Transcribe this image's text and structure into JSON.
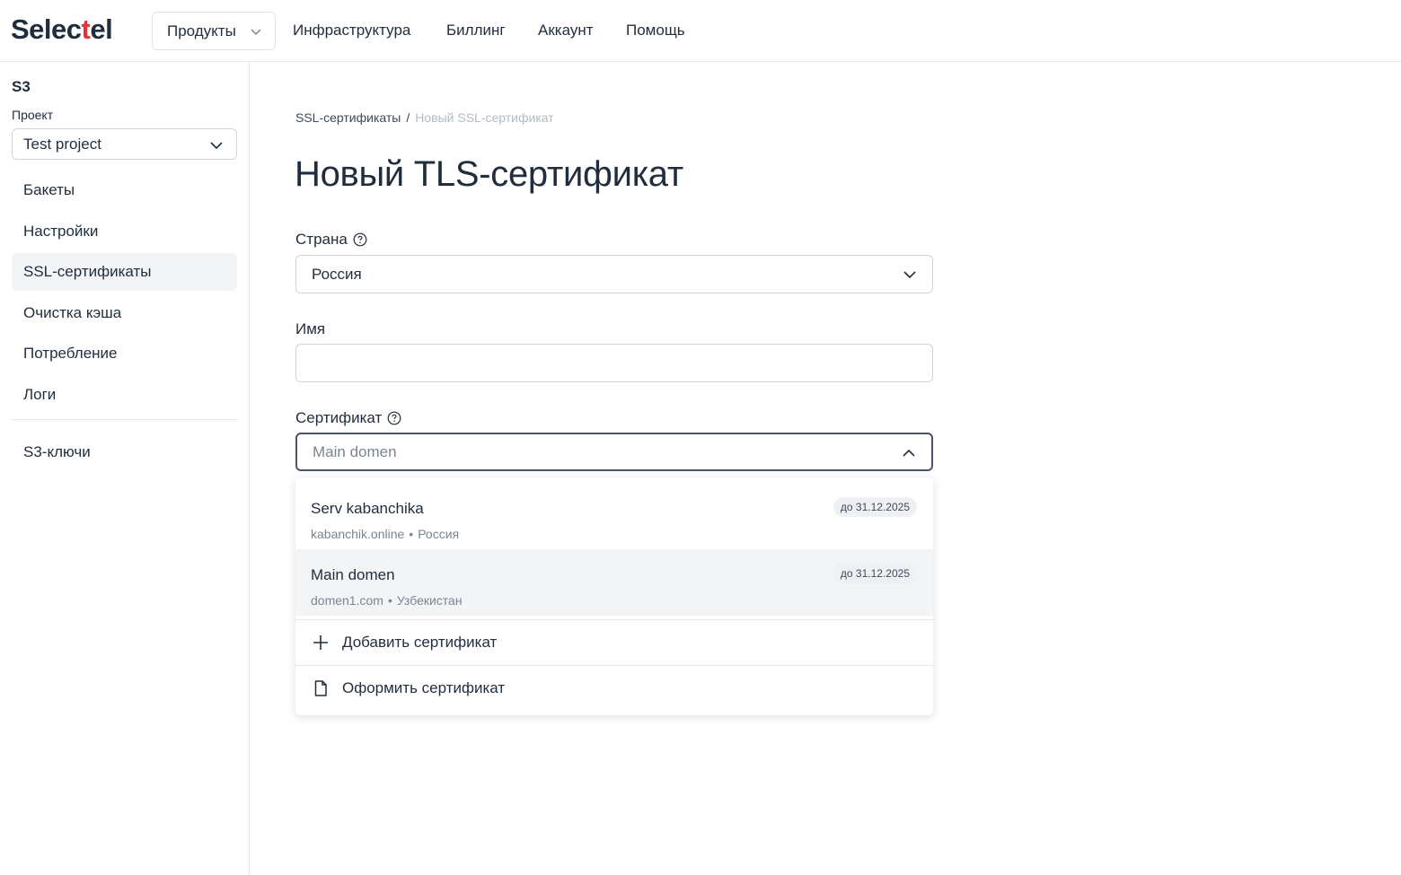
{
  "header": {
    "logo_prefix": "Selec",
    "logo_accent": "t",
    "logo_suffix": "el",
    "nav": {
      "products": "Продукты",
      "infrastructure": "Инфраструктура",
      "billing": "Биллинг",
      "account": "Аккаунт",
      "help": "Помощь"
    }
  },
  "sidebar": {
    "title": "S3",
    "project_label": "Проект",
    "project_value": "Test project",
    "items": [
      {
        "label": "Бакеты"
      },
      {
        "label": "Настройки"
      },
      {
        "label": "SSL-сертификаты"
      },
      {
        "label": "Очистка кэша"
      },
      {
        "label": "Потребление"
      },
      {
        "label": "Логи"
      }
    ],
    "keys_label": "S3-ключи"
  },
  "main": {
    "breadcrumb": {
      "parent": "SSL-сертификаты",
      "separator": "/",
      "current": "Новый SSL-сертификат"
    },
    "title": "Новый TLS-сертификат",
    "country": {
      "label": "Страна",
      "value": "Россия"
    },
    "name": {
      "label": "Имя",
      "value": ""
    },
    "certificate": {
      "label": "Сертификат",
      "placeholder": "Main domen"
    }
  },
  "dropdown": {
    "options": [
      {
        "name": "Serv kabanchika",
        "domain": "kabanchik.online",
        "separator": "•",
        "country": "Россия",
        "badge": "до 31.12.2025"
      },
      {
        "name": "Main domen",
        "domain": "domen1.com",
        "separator": "•",
        "country": "Узбекистан",
        "badge": "до 31.12.2025"
      }
    ],
    "add_label": "Добавить сертификат",
    "issue_label": "Оформить сертификат"
  },
  "colors": {
    "accent": "#e5323a",
    "text": "#1f2d3d",
    "border": "#cfd5dc",
    "hover_bg": "#f2f4f6"
  }
}
